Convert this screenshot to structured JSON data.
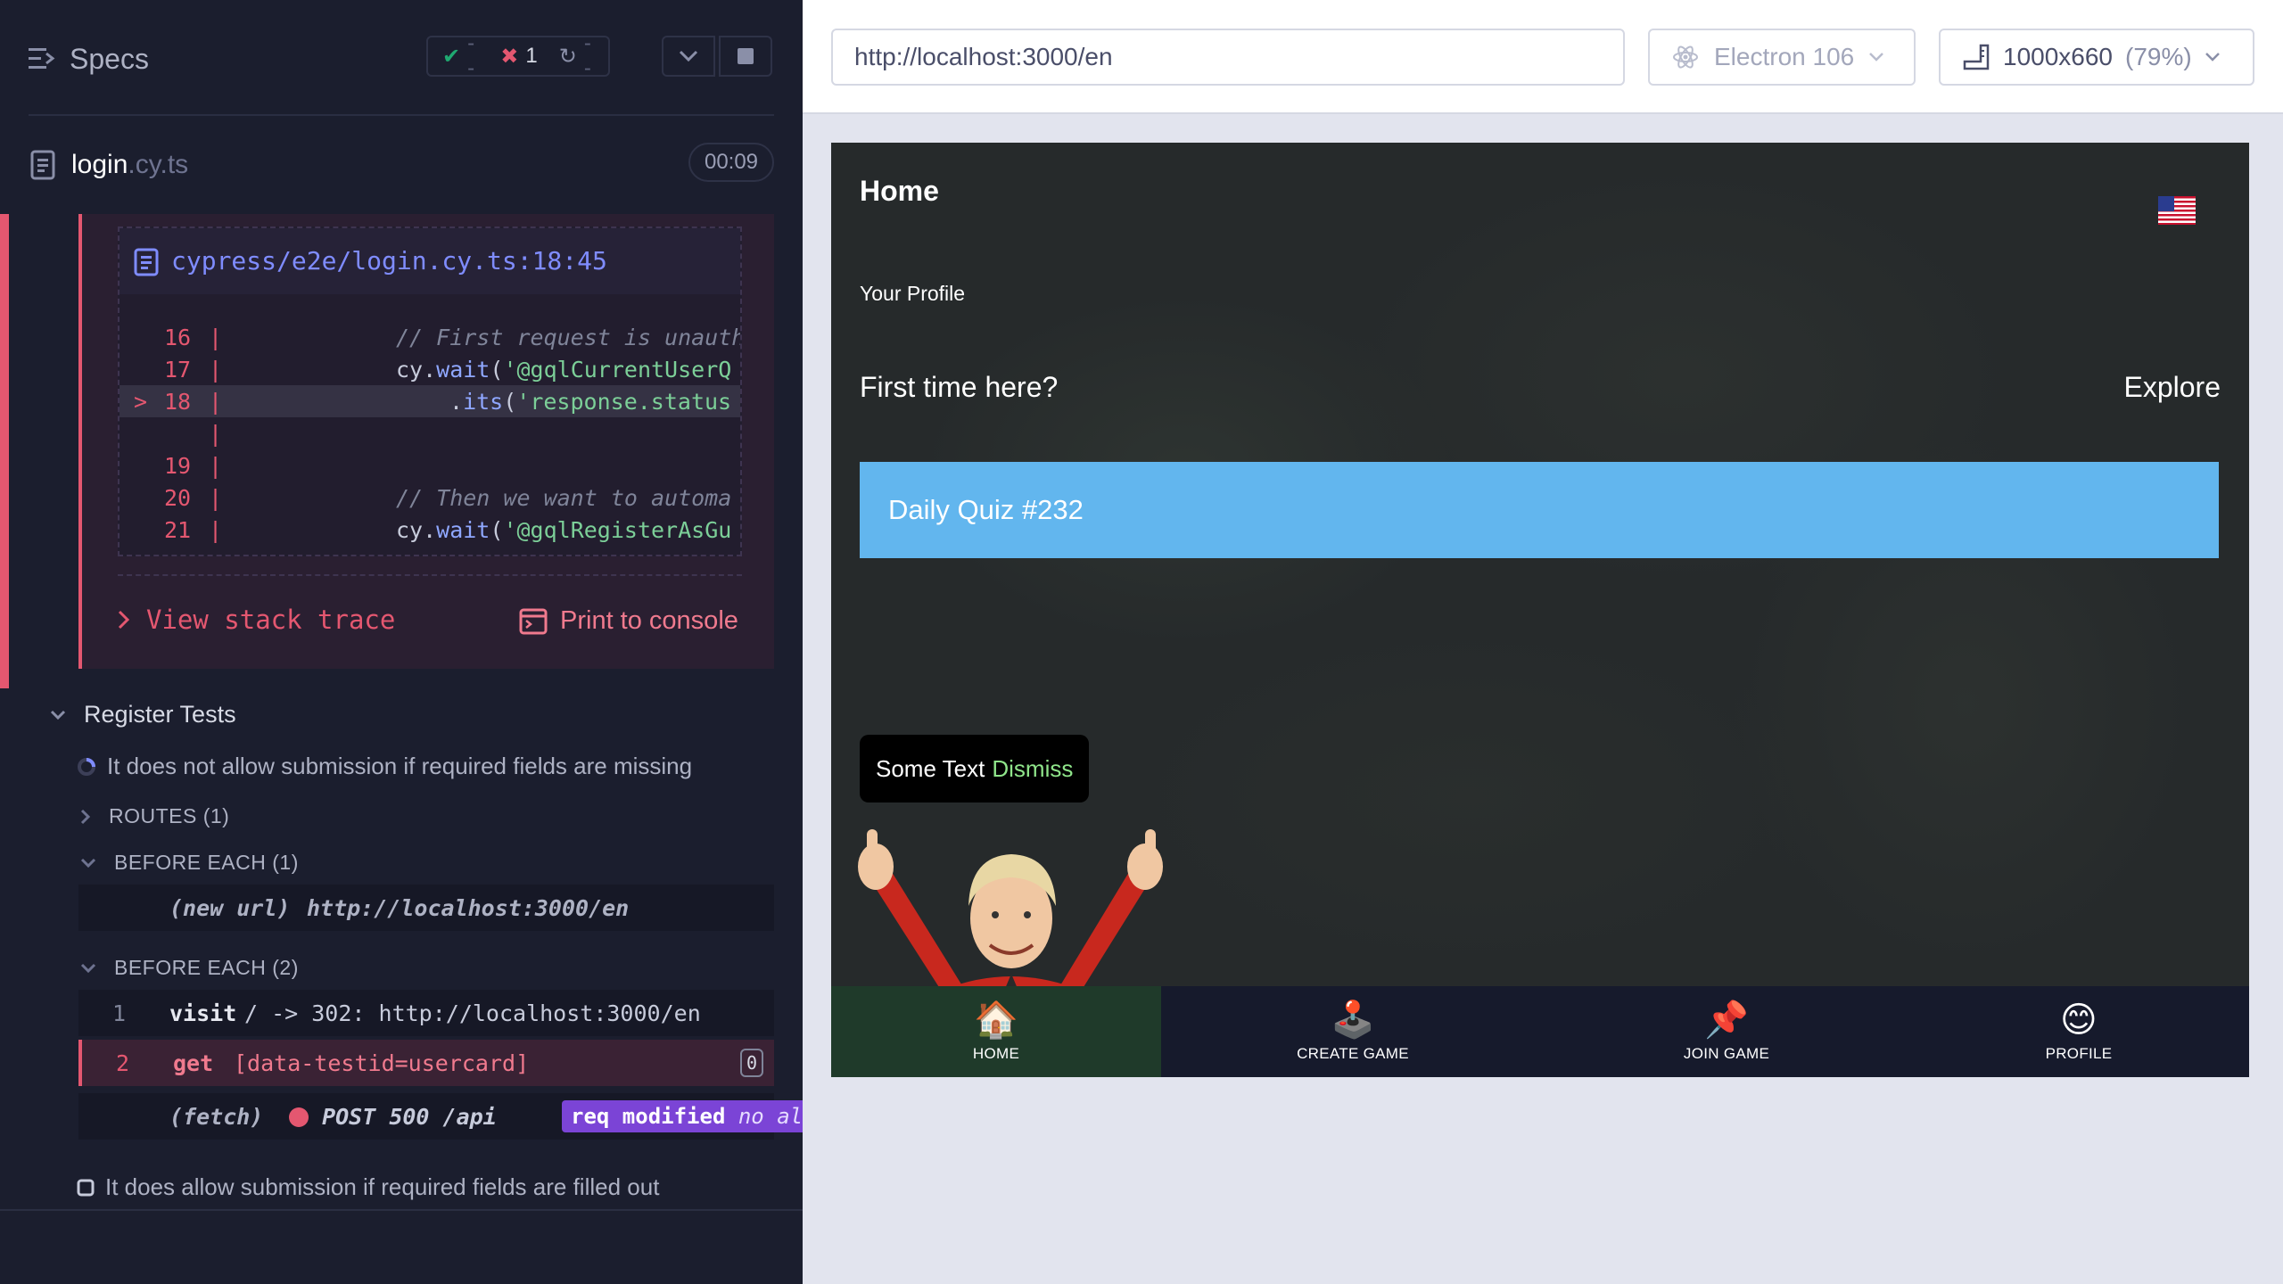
{
  "runner": {
    "title": "Specs",
    "stats": {
      "passed": "--",
      "failed": "1",
      "pending": "--"
    },
    "file": {
      "name": "login",
      "ext": ".cy.ts",
      "duration": "00:09"
    },
    "error": {
      "file_path": "cypress/e2e/login.cy.ts:18:45",
      "code_lines": [
        {
          "marker": "",
          "num": "16",
          "comment": "// First request is unauth"
        },
        {
          "marker": "",
          "num": "17",
          "prefix": "cy.",
          "fn": "wait",
          "rest": "(",
          "str": "'@gqlCurrentUserQ"
        },
        {
          "marker": ">",
          "num": "18",
          "prefix": ".",
          "fn": "its",
          "rest": "(",
          "str": "'response.status"
        },
        {
          "marker": "",
          "num": "",
          "comment": ""
        },
        {
          "marker": "",
          "num": "19",
          "comment": ""
        },
        {
          "marker": "",
          "num": "20",
          "comment": "// Then we want to automa"
        },
        {
          "marker": "",
          "num": "21",
          "prefix": "cy.",
          "fn": "wait",
          "rest": "(",
          "str": "'@gqlRegisterAsGu"
        }
      ],
      "stack_trace_label": "View stack trace",
      "print_label": "Print to console"
    },
    "suite": "Register Tests",
    "test1": "It does not allow submission if required fields are missing",
    "routes_label": "ROUTES (1)",
    "before_each_1": "BEFORE EACH (1)",
    "new_url_label": "(new url)",
    "new_url_value": "http://localhost:3000/en",
    "before_each_2": "BEFORE EACH (2)",
    "commands": [
      {
        "num": "1",
        "name": "visit",
        "message": "/ -> 302: http://localhost:3000/en"
      },
      {
        "num": "2",
        "name": "get",
        "message": "[data-testid=usercard]",
        "count": "0"
      }
    ],
    "fetch": {
      "label": "(fetch)",
      "message": "POST 500 /api",
      "badge": "req modified",
      "alias": "no alias"
    },
    "test2": "It does allow submission if required fields are filled out"
  },
  "aut": {
    "url": "http://localhost:3000/en",
    "browser": "Electron 106",
    "viewport": "1000x660",
    "scale": "(79%)"
  },
  "app": {
    "home": "Home",
    "your_profile": "Your Profile",
    "first_time": "First time here?",
    "explore": "Explore",
    "quiz": "Daily Quiz #232",
    "toast_text": "Some Text",
    "toast_dismiss": "Dismiss",
    "nav": [
      {
        "label": "HOME",
        "icon": "🏠"
      },
      {
        "label": "CREATE GAME",
        "icon": "🕹️"
      },
      {
        "label": "JOIN GAME",
        "icon": "📌"
      },
      {
        "label": "PROFILE",
        "icon": "😊"
      }
    ]
  }
}
